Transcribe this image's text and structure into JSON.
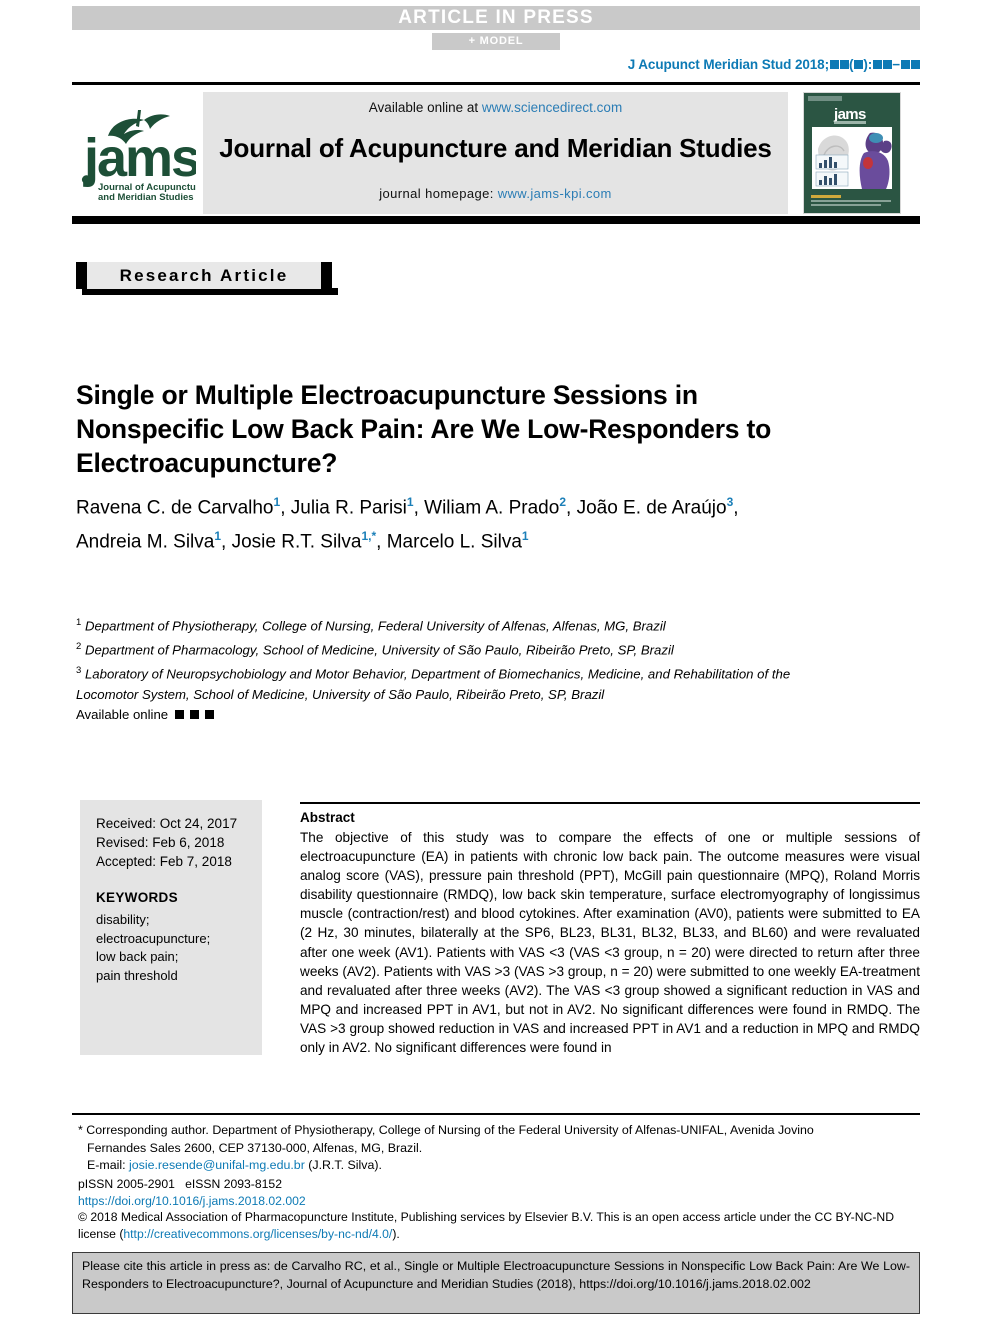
{
  "banner": {
    "press": "ARTICLE IN PRESS",
    "model": "+ MODEL"
  },
  "citation_header": {
    "prefix": "J Acupunct Meridian Stud 2018;",
    "mid": "(",
    "mid2": "):",
    "dash": "−"
  },
  "masthead": {
    "available_prefix": "Available online at ",
    "available_link": "www.sciencedirect.com",
    "journal_title": "Journal of Acupuncture and Meridian Studies",
    "homepage_prefix": "journal homepage: ",
    "homepage_link": "www.jams-kpi.com",
    "logo_wordmark": "jams",
    "logo_sub1": "Journal of Acupuncture",
    "logo_sub2": "and Meridian Studies",
    "cover_wordmark": "jams"
  },
  "article": {
    "type_badge": "Research Article",
    "title": "Single or Multiple Electroacupuncture Sessions in Nonspecific Low Back Pain: Are We Low-Responders to Electroacupuncture?",
    "authors": [
      {
        "name": "Ravena C. de Carvalho",
        "sup": "1",
        "sep": ", "
      },
      {
        "name": "Julia R. Parisi",
        "sup": "1",
        "sep": ", "
      },
      {
        "name": "Wiliam A. Prado",
        "sup": "2",
        "sep": ", "
      },
      {
        "name": "João E. de Araújo",
        "sup": "3",
        "sep": ", "
      },
      {
        "name": "Andreia M. Silva",
        "sup": "1",
        "sep": ", "
      },
      {
        "name": "Josie R.T. Silva",
        "sup": "1,*",
        "sep": ", "
      },
      {
        "name": "Marcelo L. Silva",
        "sup": "1",
        "sep": ""
      }
    ],
    "affiliations": [
      {
        "marker": "1",
        "text": "Department of Physiotherapy, College of Nursing, Federal University of Alfenas, Alfenas, MG, Brazil"
      },
      {
        "marker": "2",
        "text": "Department of Pharmacology, School of Medicine, University of São Paulo, Ribeirão Preto, SP, Brazil"
      },
      {
        "marker": "3",
        "text": "Laboratory of Neuropsychobiology and Motor Behavior, Department of Biomechanics, Medicine, and Rehabilitation of the Locomotor System, School of Medicine, University of São Paulo, Ribeirão Preto, SP, Brazil"
      }
    ],
    "available_online_label": "Available online"
  },
  "infobox": {
    "received": "Received: Oct 24, 2017",
    "revised": "Revised: Feb 6, 2018",
    "accepted": "Accepted: Feb 7, 2018",
    "keywords_heading": "KEYWORDS",
    "keywords": "disability;\nelectroacupuncture;\nlow back pain;\npain threshold"
  },
  "abstract": {
    "heading": "Abstract",
    "text": "The objective of this study was to compare the effects of one or multiple sessions of electroacupuncture (EA) in patients with chronic low back pain. The outcome measures were visual analog score (VAS), pressure pain threshold (PPT), McGill pain questionnaire (MPQ), Roland Morris disability questionnaire (RMDQ), low back skin temperature, surface electromyography of longissimus muscle (contraction/rest) and blood cytokines. After examination (AV0), patients were submitted to EA (2 Hz, 30 minutes, bilaterally at the SP6, BL23, BL31, BL32, BL33, and BL60) and were revaluated after one week (AV1). Patients with VAS <3 (VAS <3 group, n = 20) were directed to return after three weeks (AV2). Patients with VAS >3 (VAS >3 group, n = 20) were submitted to one weekly EA-treatment and revaluated after three weeks (AV2). The VAS <3 group showed a significant reduction in VAS and MPQ and increased PPT in AV1, but not in AV2. No significant differences were found in RMDQ. The VAS >3 group showed reduction in VAS and increased PPT in AV1 and a reduction in MPQ and RMDQ only in AV2. No significant differences were found in"
  },
  "footer": {
    "corresponding_line1": "* Corresponding author. Department of Physiotherapy, College of Nursing of the Federal University of Alfenas-UNIFAL, Avenida Jovino",
    "corresponding_line2": "Fernandes Sales 2600, CEP 37130-000, Alfenas, MG, Brazil.",
    "email_label": "E-mail: ",
    "email": "josie.resende@unifal-mg.edu.br",
    "email_suffix": " (J.R.T. Silva).",
    "pissn": "pISSN 2005-2901",
    "eissn": "eISSN 2093-8152",
    "doi": "https://doi.org/10.1016/j.jams.2018.02.002",
    "copyright_pre": "© 2018 Medical Association of Pharmacopuncture Institute, Publishing services by Elsevier B.V. This is an open access article under the CC BY-NC-ND license (",
    "license_link": "http://creativecommons.org/licenses/by-nc-nd/4.0/",
    "copyright_post": ")."
  },
  "cite_box": {
    "text": "Please cite this article in press as: de Carvalho RC, et al., Single or Multiple Electroacupuncture Sessions in Nonspecific Low Back Pain: Are We Low-Responders to Electroacupuncture?, Journal of Acupuncture and Meridian Studies (2018), https://doi.org/10.1016/j.jams.2018.02.002"
  },
  "colors": {
    "link_blue": "#0d7ab5",
    "banner_gray": "#c9c9c9",
    "band_gray": "#e4e4e4",
    "logo_green": "#1d4f37"
  }
}
